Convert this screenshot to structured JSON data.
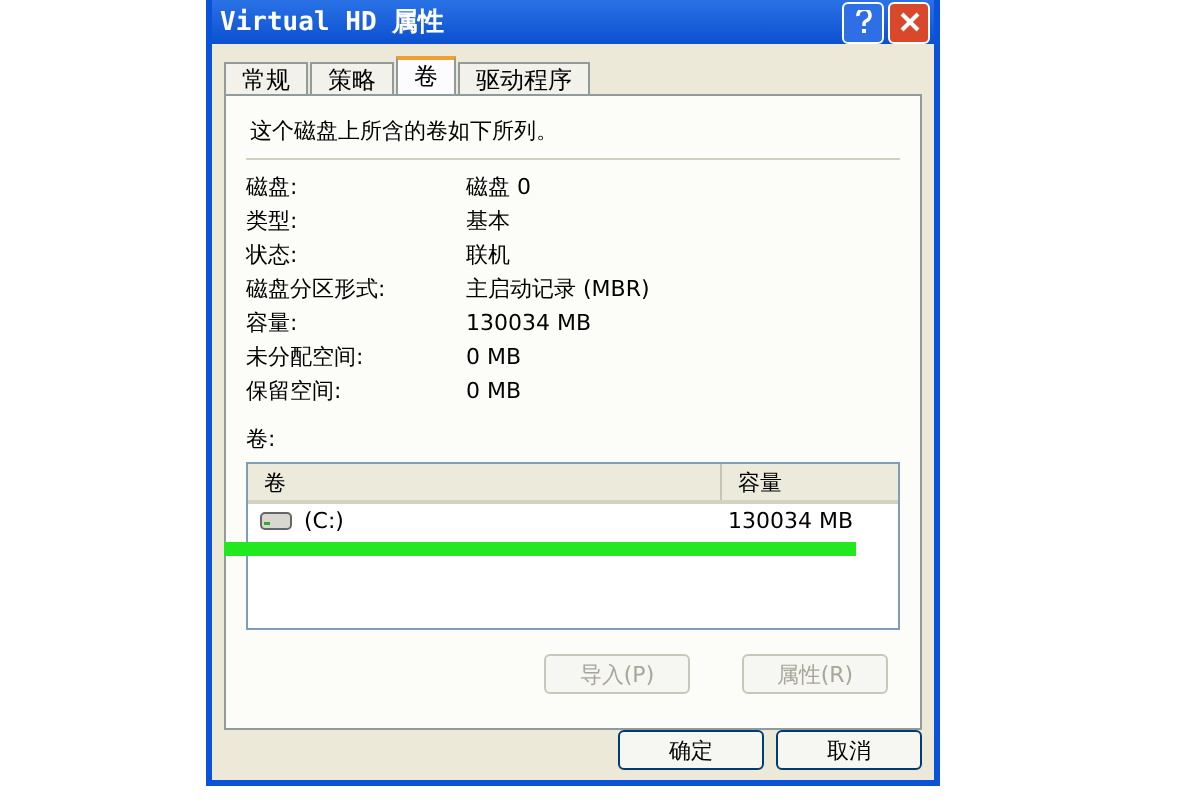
{
  "window": {
    "title": "Virtual HD 属性"
  },
  "tabs": [
    {
      "label": "常规",
      "selected": false
    },
    {
      "label": "策略",
      "selected": false
    },
    {
      "label": "卷",
      "selected": true
    },
    {
      "label": "驱动程序",
      "selected": false
    }
  ],
  "intro": "这个磁盘上所含的卷如下所列。",
  "properties": [
    {
      "label": "磁盘:",
      "value": "磁盘 0"
    },
    {
      "label": "类型:",
      "value": "基本"
    },
    {
      "label": "状态:",
      "value": "联机"
    },
    {
      "label": "磁盘分区形式:",
      "value": "主启动记录 (MBR)"
    },
    {
      "label": "容量:",
      "value": "130034 MB"
    },
    {
      "label": "未分配空间:",
      "value": "0 MB"
    },
    {
      "label": "保留空间:",
      "value": "0 MB"
    }
  ],
  "volumes": {
    "label": "卷:",
    "columns": [
      "卷",
      "容量"
    ],
    "rows": [
      {
        "name": "(C:)",
        "capacity": "130034 MB",
        "highlighted": true
      }
    ]
  },
  "panel_buttons": [
    {
      "label": "导入(P)",
      "disabled": true
    },
    {
      "label": "属性(R)",
      "disabled": true
    }
  ],
  "dialog_buttons": [
    {
      "label": "确定",
      "disabled": false
    },
    {
      "label": "取消",
      "disabled": false
    }
  ]
}
